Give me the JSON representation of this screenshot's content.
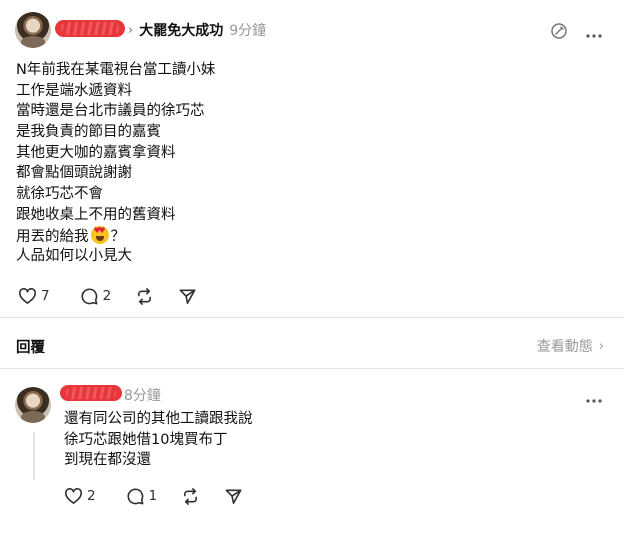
{
  "post": {
    "topic": "大罷免大成功",
    "time": "9分鐘",
    "lines": [
      "N年前我在某電視台當工讀小妹",
      "工作是端水遞資料",
      "當時還是台北市議員的徐巧芯",
      "是我負責的節目的嘉賓",
      "其他更大咖的嘉賓拿資料",
      "都會點個頭說謝謝",
      "就徐巧芯不會",
      "跟她收桌上不用的舊資料",
      "用丟的給我",
      "？",
      "人品如何以小見大"
    ],
    "likes": "7",
    "comments": "2"
  },
  "replies_section": {
    "title": "回覆",
    "view_activity": "查看動態"
  },
  "comment": {
    "time": "8分鐘",
    "lines": [
      "還有同公司的其他工讀跟我說",
      "徐巧芯跟她借10塊買布丁",
      "到現在都沒還"
    ],
    "likes": "2",
    "comments": "1"
  },
  "icons": {
    "chevron": "chevron-right-icon",
    "edit": "edit-circle-icon",
    "more": "more-horizontal-icon",
    "like": "heart-icon",
    "comment": "comment-bubble-icon",
    "repost": "repost-icon",
    "share": "send-icon",
    "emoji": "heart-eyes-emoji"
  },
  "colors": {
    "redaction": "#e8363a",
    "muted": "#999999",
    "text": "#101010"
  }
}
